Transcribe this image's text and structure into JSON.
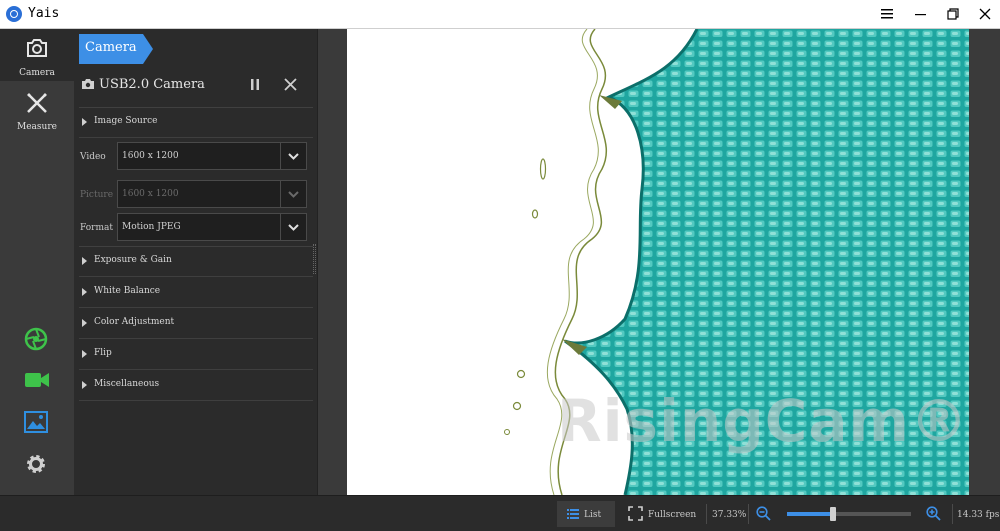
{
  "window": {
    "title": "Yais"
  },
  "rail": {
    "camera_label": "Camera",
    "measure_label": "Measure"
  },
  "panel": {
    "tab_label": "Camera",
    "device_name": "USB2.0 Camera",
    "image_source_label": "Image Source",
    "video_label": "Video",
    "video_value": "1600 x 1200",
    "picture_label": "Picture",
    "picture_value": "1600 x 1200",
    "format_label": "Format",
    "format_value": "Motion JPEG",
    "sections": {
      "exposure": "Exposure & Gain",
      "white_balance": "White Balance",
      "color": "Color Adjustment",
      "flip": "Flip",
      "misc": "Miscellaneous"
    }
  },
  "viewer": {
    "watermark": "RisingCam®"
  },
  "statusbar": {
    "list_label": "List",
    "fullscreen_label": "Fullscreen",
    "zoom_text": "37.33%",
    "zoom_fraction": 0.37,
    "fps_text": "14.33 fps"
  },
  "colors": {
    "accent": "#3d8fe6",
    "green_icon": "#3ec24a",
    "blue_icon": "#2f8fe0"
  }
}
